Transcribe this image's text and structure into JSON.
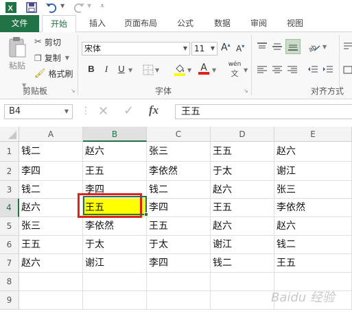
{
  "quick_access": {
    "icons": [
      "excel-logo-icon",
      "save-icon",
      "undo-icon",
      "redo-icon",
      "customize-icon"
    ]
  },
  "tabs": [
    {
      "label": "文件"
    },
    {
      "label": "开始"
    },
    {
      "label": "插入"
    },
    {
      "label": "页面布局"
    },
    {
      "label": "公式"
    },
    {
      "label": "数据"
    },
    {
      "label": "审阅"
    },
    {
      "label": "视图"
    }
  ],
  "ribbon": {
    "clipboard": {
      "paste": "粘贴",
      "cut": "剪切",
      "copy": "复制",
      "format_painter": "格式刷",
      "group": "剪贴板"
    },
    "font": {
      "name": "宋体",
      "size": "11",
      "grow": "A",
      "shrink": "A",
      "bold": "B",
      "italic": "I",
      "underline": "U",
      "font_color_glyph": "A",
      "phonetic": "wén",
      "group": "字体"
    },
    "alignment": {
      "group": "对齐方式"
    }
  },
  "formula_bar": {
    "name_box": "B4",
    "cancel": "✕",
    "enter": "✓",
    "fx": "fx",
    "value": "王五"
  },
  "columns": [
    "A",
    "B",
    "C",
    "D",
    "E"
  ],
  "rows": [
    "1",
    "2",
    "3",
    "4",
    "5",
    "6",
    "7",
    "8",
    "9"
  ],
  "cells": [
    [
      "钱二",
      "赵六",
      "张三",
      "王五",
      "赵六"
    ],
    [
      "李四",
      "王五",
      "李依然",
      "于太",
      "谢江"
    ],
    [
      "钱二",
      "李四",
      "钱二",
      "赵六",
      "张三"
    ],
    [
      "赵六",
      "王五",
      "李四",
      "王五",
      "李依然"
    ],
    [
      "张三",
      "李依然",
      "王五",
      "赵六",
      "赵六"
    ],
    [
      "王五",
      "于太",
      "于太",
      "谢江",
      "钱二"
    ],
    [
      "赵六",
      "谢江",
      "李四",
      "钱二",
      "王五"
    ],
    [
      "",
      "",
      "",
      "",
      ""
    ],
    [
      "",
      "",
      "",
      "",
      ""
    ]
  ],
  "selection": {
    "cell": "B4",
    "fill_color": "#ffff00"
  },
  "colors": {
    "accent": "#217346",
    "highlight_box": "#e0201b"
  },
  "watermark": "Baidu 经验"
}
